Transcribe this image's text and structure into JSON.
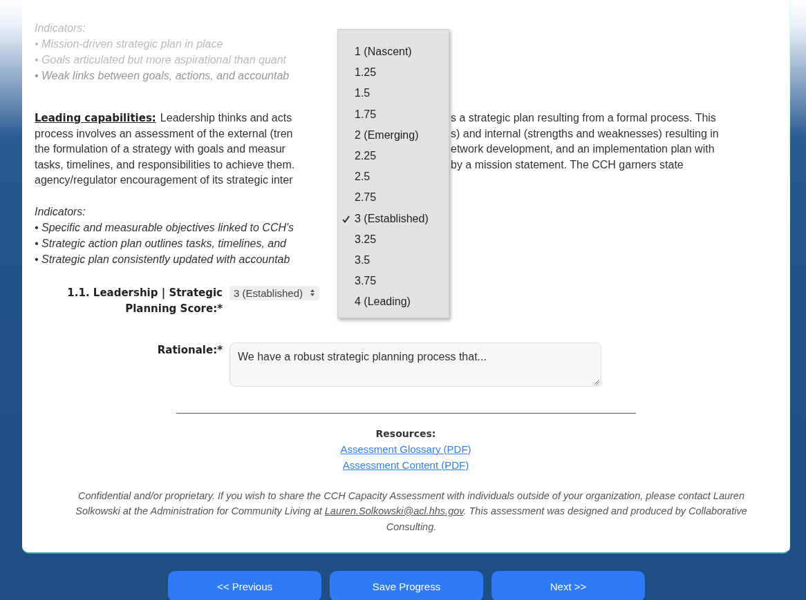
{
  "previous_indicators": {
    "label": "Indicators:",
    "items": [
      "• Mission-driven strategic plan in place",
      "• Goals articulated but more aspirational than quant",
      "• Weak links between goals, actions, and accountab"
    ]
  },
  "leading": {
    "heading": "Leading capabilities:",
    "lines": [
      {
        "left": "Leadership thinks and acts",
        "right": "s a strategic plan resulting from a formal process. This"
      },
      {
        "left": "process involves an assessment of the external (tren",
        "right": "s) and internal (strengths and weaknesses) resulting in"
      },
      {
        "left": "the formulation of a strategy with goals and measur",
        "right": "etwork development, and an implementation plan with"
      },
      {
        "left": "tasks, timelines, and responsibilities to achieve them.",
        "right": "by a mission statement. The CCH garners state"
      },
      {
        "left": "agency/regulator encouragement of its strategic inter"
      }
    ],
    "indicators_label": "Indicators:",
    "indicators": [
      "• Specific and measurable objectives linked to CCH's",
      "• Strategic action plan outlines tasks, timelines, and",
      "• Strategic plan consistently updated with accountab"
    ]
  },
  "score": {
    "label": "1.1. Leadership | Strategic Planning Score:*",
    "value": "3 (Established)"
  },
  "dropdown": {
    "options": [
      {
        "label": "1 (Nascent)",
        "selected": false
      },
      {
        "label": "1.25",
        "selected": false
      },
      {
        "label": "1.5",
        "selected": false
      },
      {
        "label": "1.75",
        "selected": false
      },
      {
        "label": "2 (Emerging)",
        "selected": false
      },
      {
        "label": "2.25",
        "selected": false
      },
      {
        "label": "2.5",
        "selected": false
      },
      {
        "label": "2.75",
        "selected": false
      },
      {
        "label": "3 (Established)",
        "selected": true
      },
      {
        "label": "3.25",
        "selected": false
      },
      {
        "label": "3.5",
        "selected": false
      },
      {
        "label": "3.75",
        "selected": false
      },
      {
        "label": "4 (Leading)",
        "selected": false
      }
    ]
  },
  "rationale": {
    "label": "Rationale:*",
    "value": "We have a robust strategic planning process that..."
  },
  "resources": {
    "title": "Resources:",
    "links": [
      "Assessment Glossary (PDF)",
      "Assessment Content (PDF)"
    ]
  },
  "footer": {
    "before": "Confidential and/or proprietary. If you wish to share the CCH Capacity Assessment with individuals outside of your organization, please contact Lauren Solkowski at the Administration for Community Living at",
    "email": "Lauren.Solkowski@acl.hhs.gov",
    "after": ". This assessment was designed and produced by Collaborative Consulting."
  },
  "buttons": [
    "<< Previous",
    "Save Progress",
    "Next >>"
  ]
}
